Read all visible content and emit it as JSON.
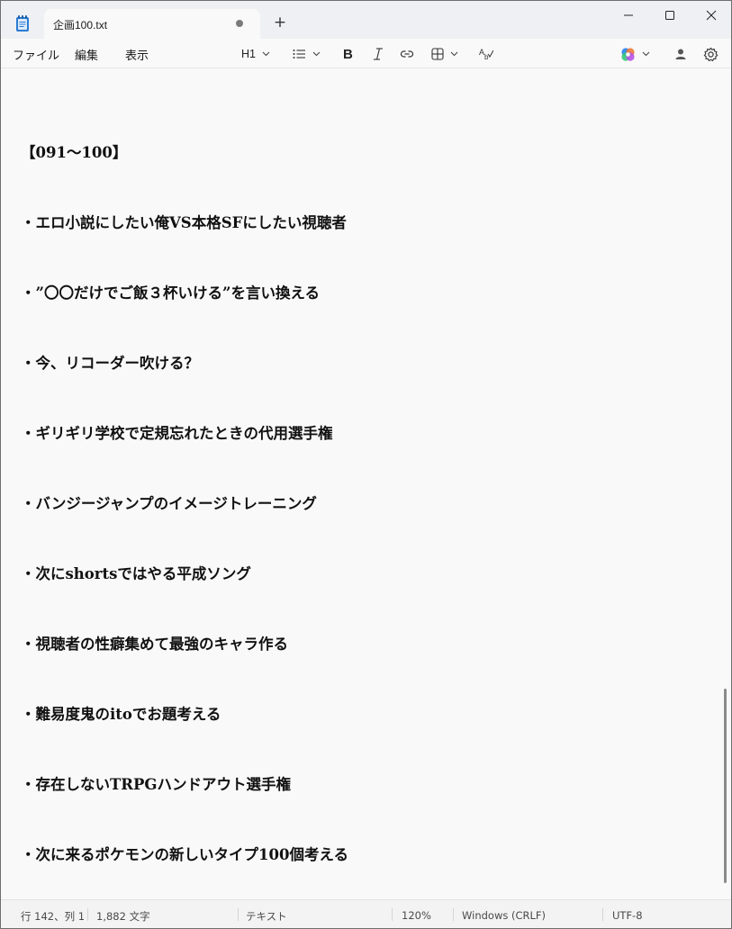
{
  "tab": {
    "title": "企画100.txt"
  },
  "menu": {
    "file": "ファイル",
    "edit": "編集",
    "view": "表示"
  },
  "toolbar": {
    "heading": "H1",
    "bold_icon": "bold-icon",
    "italic_icon": "italic-icon",
    "link_icon": "link-icon",
    "table_icon": "table-icon",
    "spellcheck_icon": "spellcheck-icon",
    "copilot_icon": "copilot-icon",
    "account_icon": "account-icon",
    "settings_icon": "gear-icon"
  },
  "editor": {
    "lines": [
      "【091～100】",
      "・エロ小説にしたい俺VS本格SFにしたい視聴者",
      "・”〇〇だけでご飯３杯いける”を言い換える",
      "・今、リコーダー吹ける？",
      "・ギリギリ学校で定規忘れたときの代用選手権",
      "・バンジージャンプのイメージトレーニング",
      "・次にshortsではやる平成ソング",
      "・視聴者の性癖集めて最強のキャラ作る",
      "・難易度鬼のitoでお題考える",
      "・存在しないTRPGハンドアウト選手権",
      "・次に来るポケモンの新しいタイプ100個考える"
    ]
  },
  "status": {
    "position": "行 142、列 1",
    "chars": "1,882 文字",
    "format": "テキスト",
    "zoom": "120%",
    "line_ending": "Windows (CRLF)",
    "encoding": "UTF-8"
  },
  "colors": {
    "background": "#f9f9f9",
    "titlebar": "#eef0f3",
    "statusbar": "#f3f3f3",
    "text": "#111111"
  }
}
